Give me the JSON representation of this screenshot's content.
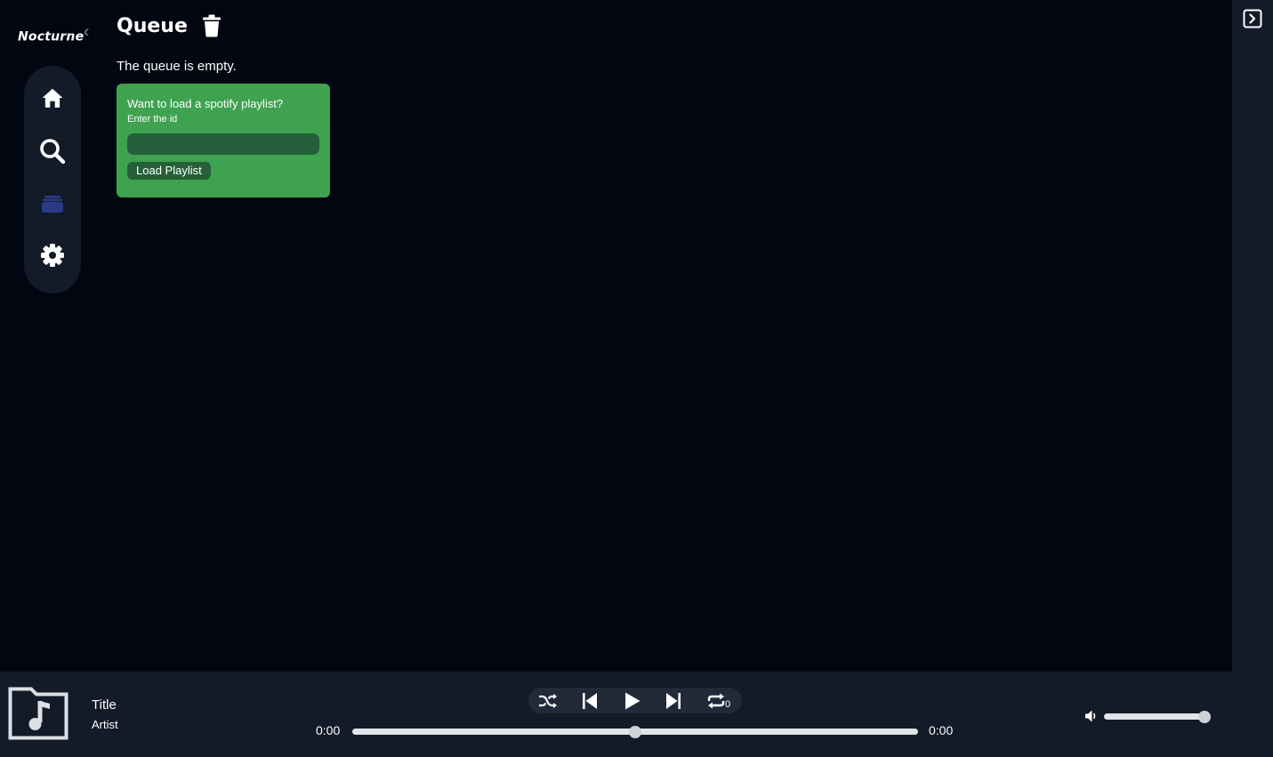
{
  "app": {
    "name": "Nocturne",
    "name_mark": "☾"
  },
  "nav": {
    "items": [
      {
        "name": "home",
        "icon": "home-icon",
        "active": false
      },
      {
        "name": "search",
        "icon": "search-icon",
        "active": false
      },
      {
        "name": "queue",
        "icon": "stack-icon",
        "active": true
      },
      {
        "name": "settings",
        "icon": "gear-icon",
        "active": false
      }
    ],
    "active_color": "#2b3a86"
  },
  "page": {
    "title": "Queue",
    "title_icon": "trash-icon",
    "empty_message": "The queue is empty."
  },
  "playlist_card": {
    "question": "Want to load a spotify playlist?",
    "hint": "Enter the id",
    "input_value": "",
    "input_placeholder": "",
    "button_label": "Load Playlist",
    "accent": "#3fa250"
  },
  "player": {
    "cover_icon": "music-note-icon",
    "title": "Title",
    "artist": "Artist",
    "controls": [
      "shuffle-icon",
      "previous-icon",
      "play-icon",
      "next-icon",
      "repeat-icon"
    ],
    "repeat_count": "0",
    "current_time": "0:00",
    "total_time": "0:00",
    "seek_fraction": 0.5,
    "volume_fraction": 1.0
  },
  "right_panel": {
    "toggle_icon": "panel-expand-icon"
  },
  "colors": {
    "background": "#020611",
    "panel": "#131a28",
    "controls_bg": "#222a3a"
  }
}
